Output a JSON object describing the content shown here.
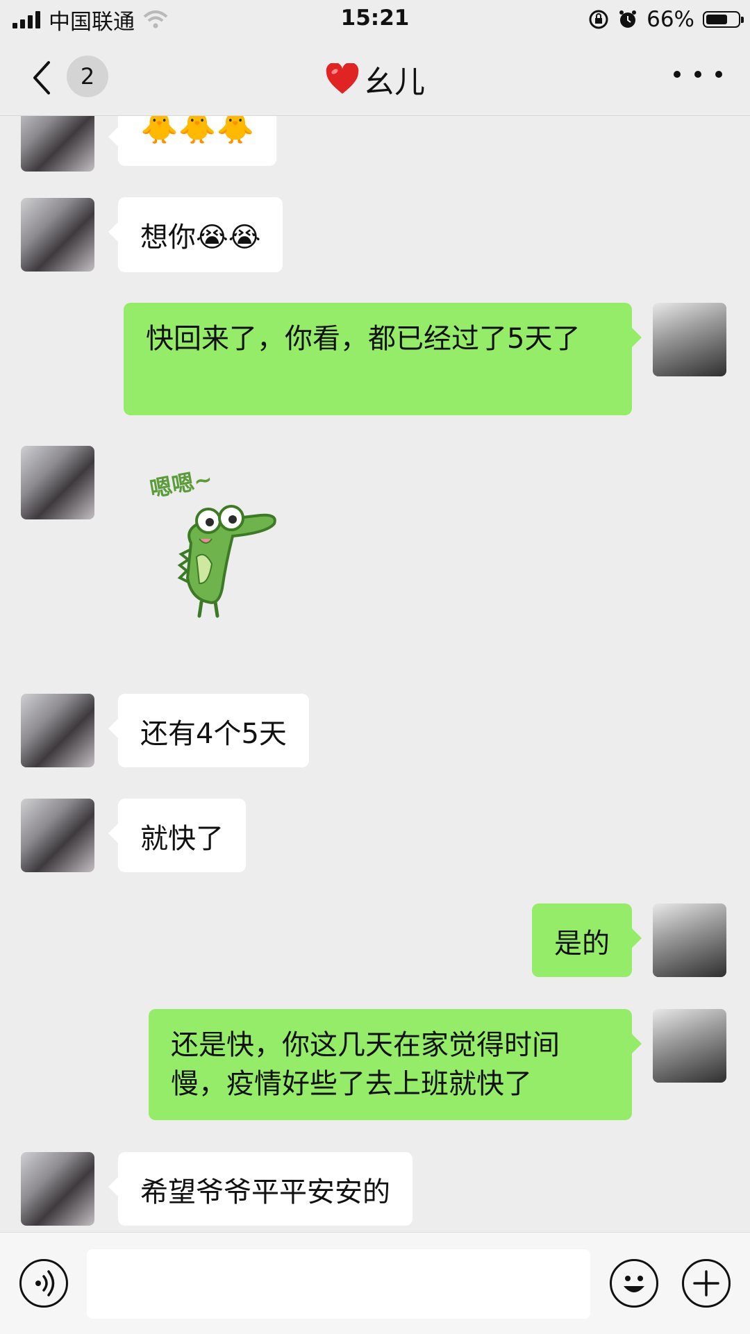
{
  "status_bar": {
    "carrier": "中国联通",
    "time": "15:21",
    "battery_percent": "66%",
    "icons": [
      "signal-icon",
      "wifi-icon",
      "orientation-lock-icon",
      "alarm-icon",
      "battery-icon"
    ]
  },
  "nav": {
    "unread_count": "2",
    "title_emoji": "❤️",
    "title": "幺儿",
    "icons": [
      "back-chevron-icon",
      "more-dots-icon"
    ]
  },
  "messages": [
    {
      "sender": "her",
      "type": "text",
      "text": "🐥🐥🐥"
    },
    {
      "sender": "her",
      "type": "text",
      "text": "想你😭😭"
    },
    {
      "sender": "me",
      "type": "text",
      "text": "快回来了，你看，都已经过了5天了"
    },
    {
      "sender": "her",
      "type": "sticker",
      "sticker_text": "嗯嗯~",
      "sticker": "crocodile-sticker"
    },
    {
      "sender": "her",
      "type": "text",
      "text": "还有4个5天"
    },
    {
      "sender": "her",
      "type": "text",
      "text": "就快了"
    },
    {
      "sender": "me",
      "type": "text",
      "text": "是的"
    },
    {
      "sender": "me",
      "type": "text",
      "text": "还是快，你这几天在家觉得时间慢，疫情好些了去上班就快了"
    },
    {
      "sender": "her",
      "type": "text",
      "text": "希望爷爷平平安安的"
    }
  ],
  "input_bar": {
    "value": "",
    "icons": [
      "voice-icon",
      "emoji-icon",
      "plus-icon"
    ]
  },
  "colors": {
    "background": "#ededed",
    "my_bubble": "#95ec69",
    "her_bubble": "#ffffff"
  }
}
